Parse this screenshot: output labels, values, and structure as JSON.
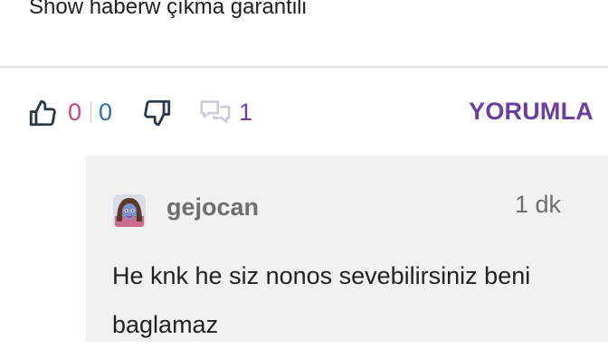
{
  "post": {
    "text": "Show haberw çıkma garantili"
  },
  "actions": {
    "like_count": "0",
    "dislike_count": "0",
    "comment_count": "1",
    "reply_label": "YORUMLA"
  },
  "reply": {
    "author": "gejocan",
    "time": "1 dk",
    "text": "He knk he siz nonos sevebilirsiniz beni baglamaz"
  },
  "colors": {
    "accent": "#6b3fa0",
    "like_count": "#d0427f",
    "dislike_count": "#2f6ea8",
    "icon": "#2b3848",
    "muted_icon": "#c9ccd6",
    "reply_bg": "#f1f1f1"
  },
  "icons": [
    "thumbs-up-icon",
    "thumbs-down-icon",
    "comment-bubbles-icon"
  ]
}
